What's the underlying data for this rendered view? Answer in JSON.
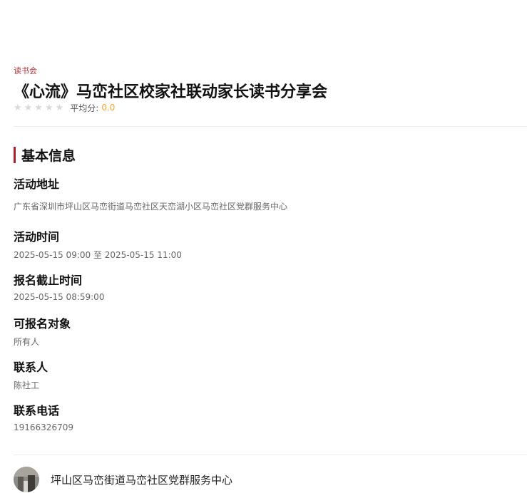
{
  "header": {
    "category": "读书会",
    "title": "《心流》马峦社区校家社联动家长读书分享会",
    "rating": {
      "stars_total": 5,
      "stars_filled": 0,
      "avg_label": "平均分:",
      "avg_value": "0.0",
      "star_color": "#dadada",
      "value_color": "#f5a623"
    }
  },
  "basic_info": {
    "section_title": "基本信息",
    "accent_color": "#a3232c",
    "fields": [
      {
        "label": "活动地址",
        "value": "广东省深圳市坪山区马峦街道马峦社区天峦湖小区马峦社区党群服务中心"
      },
      {
        "label": "活动时间",
        "value": "2025-05-15 09:00 至 2025-05-15 11:00"
      },
      {
        "label": "报名截止时间",
        "value": "2025-05-15 08:59:00"
      },
      {
        "label": "可报名对象",
        "value": "所有人"
      },
      {
        "label": "联系人",
        "value": "陈社工"
      },
      {
        "label": "联系电话",
        "value": "19166326709"
      }
    ]
  },
  "organizer": {
    "name": "坪山区马峦街道马峦社区党群服务中心"
  }
}
